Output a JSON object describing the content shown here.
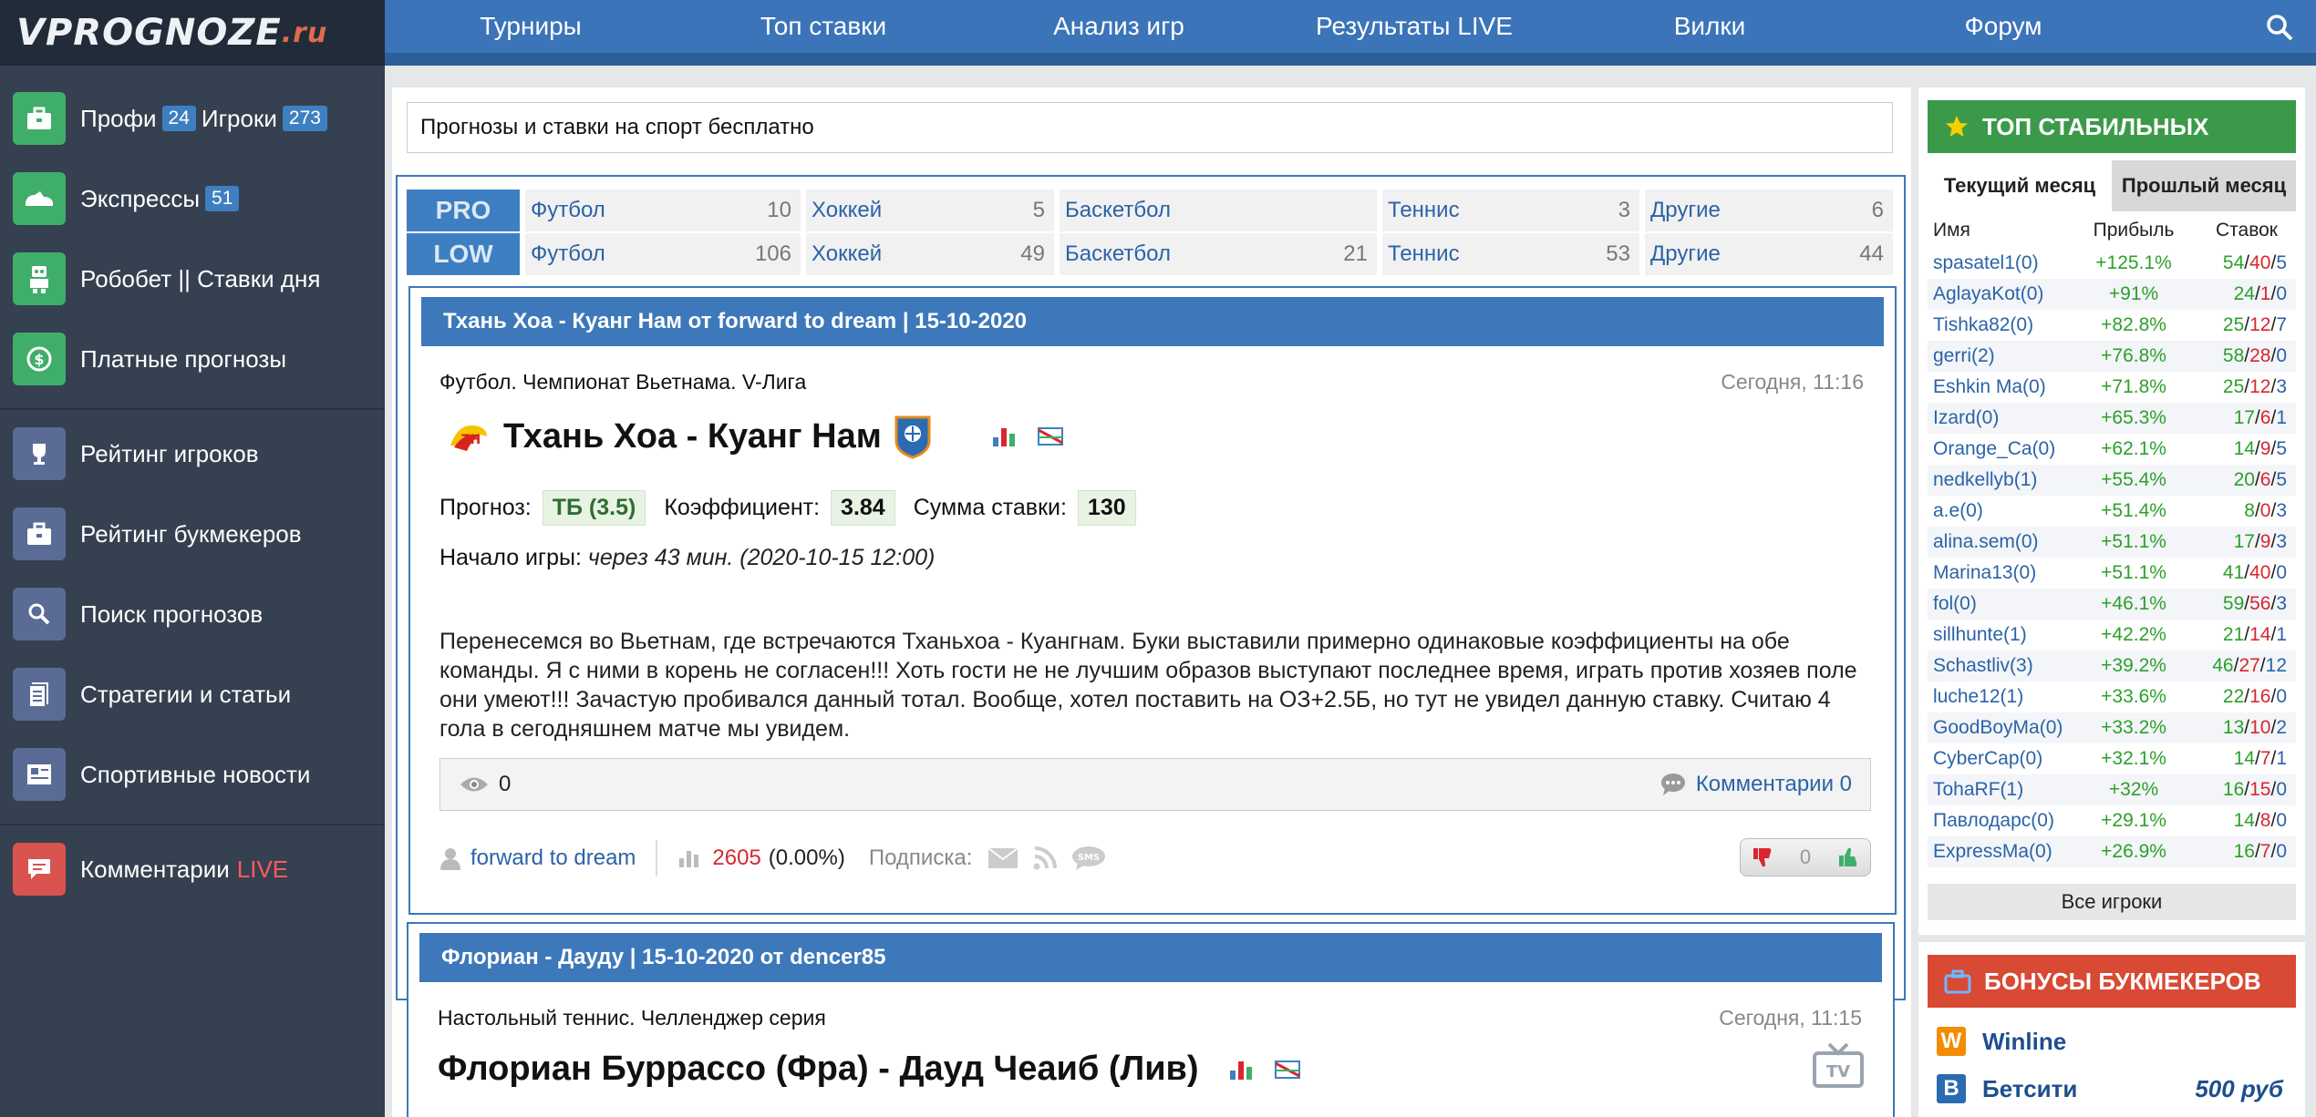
{
  "logo": {
    "main": "VPROGNOZE",
    "tld": ".ru"
  },
  "sidebar": {
    "items": [
      {
        "label": "Профи",
        "badge": "24",
        "label2": "Игроки",
        "badge2": "273"
      },
      {
        "label": "Экспрессы",
        "badge": "51"
      },
      {
        "label": "Робобет || Ставки дня"
      },
      {
        "label": "Платные прогнозы"
      },
      {
        "label": "Рейтинг игроков"
      },
      {
        "label": "Рейтинг букмекеров"
      },
      {
        "label": "Поиск прогнозов"
      },
      {
        "label": "Стратегии и статьи"
      },
      {
        "label": "Спортивные новости"
      },
      {
        "label": "Комментарии",
        "live": "LIVE"
      }
    ]
  },
  "topnav": {
    "items": [
      "Турниры",
      "Топ ставки",
      "Анализ игр",
      "Результаты LIVE",
      "Вилки",
      "Форум"
    ]
  },
  "headline": "Прогнозы и ставки на спорт бесплатно",
  "categories": {
    "pro": {
      "label": "PRO",
      "cells": [
        {
          "name": "Футбол",
          "count": "10"
        },
        {
          "name": "Хоккей",
          "count": "5"
        },
        {
          "name": "Баскетбол",
          "count": ""
        },
        {
          "name": "Теннис",
          "count": "3"
        },
        {
          "name": "Другие",
          "count": "6"
        }
      ]
    },
    "low": {
      "label": "LOW",
      "cells": [
        {
          "name": "Футбол",
          "count": "106"
        },
        {
          "name": "Хоккей",
          "count": "49"
        },
        {
          "name": "Баскетбол",
          "count": "21"
        },
        {
          "name": "Теннис",
          "count": "53"
        },
        {
          "name": "Другие",
          "count": "44"
        }
      ]
    }
  },
  "pred1": {
    "header": "Тхань Хоа - Куанг Нам от forward to dream | 15-10-2020",
    "league": "Футбол. Чемпионат Вьетнама. V-Лига",
    "time": "Сегодня, 11:16",
    "title": "Тхань Хоа - Куанг Нам",
    "forecast_label": "Прогноз:",
    "forecast": "ТБ (3.5)",
    "coef_label": "Коэффициент:",
    "coef": "3.84",
    "stake_label": "Сумма ставки:",
    "stake": "130",
    "start_label": "Начало игры:",
    "start": "через 43 мин. (2020-10-15 12:00)",
    "description": "Перенесемся во Вьетнам, где встречаются Тханьхоа - Куангнам. Буки выставили примерно одинаковые коэффициенты на обе команды. Я с ними в корень не согласен!!! Хоть гости не не лучшим образов выступают последнее время, играть против хозяев поле они умеют!!! Зачастую пробивался данный тотал. Вообще, хотел поставить на ОЗ+2.5Б, но тут не увидел данную ставку. Считаю 4 гола в сегодняшнем матче мы увидем.",
    "views": "0",
    "comments": "Комментарии 0",
    "author": "forward to dream",
    "rating": "2605",
    "rating_pct": "(0.00%)",
    "subscribe": "Подписка:",
    "votes": "0"
  },
  "pred2": {
    "header": "Флориан - Дауду | 15-10-2020 от dencer85",
    "league": "Настольный теннис. Челленджер серия",
    "time": "Сегодня, 11:15",
    "title": "Флориан Буррассо (Фра) - Дауд Чеаиб (Лив)"
  },
  "top": {
    "title": "ТОП СТАБИЛЬНЫХ",
    "tab_current": "Текущий месяц",
    "tab_past": "Прошлый месяц",
    "col_name": "Имя",
    "col_profit": "Прибыль",
    "col_bets": "Ставок",
    "rows": [
      {
        "name": "spasatel1(0)",
        "profit": "+125.1%",
        "w": "54",
        "l": "40",
        "d": "5"
      },
      {
        "name": "AglayaKot(0)",
        "profit": "+91%",
        "w": "24",
        "l": "1",
        "d": "0"
      },
      {
        "name": "Tishka82(0)",
        "profit": "+82.8%",
        "w": "25",
        "l": "12",
        "d": "7"
      },
      {
        "name": "gerri(2)",
        "profit": "+76.8%",
        "w": "58",
        "l": "28",
        "d": "0"
      },
      {
        "name": "Eshkin Ma(0)",
        "profit": "+71.8%",
        "w": "25",
        "l": "12",
        "d": "3"
      },
      {
        "name": "Izard(0)",
        "profit": "+65.3%",
        "w": "17",
        "l": "6",
        "d": "1"
      },
      {
        "name": "Orange_Ca(0)",
        "profit": "+62.1%",
        "w": "14",
        "l": "9",
        "d": "5"
      },
      {
        "name": "nedkellyb(1)",
        "profit": "+55.4%",
        "w": "20",
        "l": "6",
        "d": "5"
      },
      {
        "name": "a.e(0)",
        "profit": "+51.4%",
        "w": "8",
        "l": "0",
        "d": "3"
      },
      {
        "name": "alina.sem(0)",
        "profit": "+51.1%",
        "w": "17",
        "l": "9",
        "d": "3"
      },
      {
        "name": "Marina13(0)",
        "profit": "+51.1%",
        "w": "41",
        "l": "40",
        "d": "0"
      },
      {
        "name": "fol(0)",
        "profit": "+46.1%",
        "w": "59",
        "l": "56",
        "d": "3"
      },
      {
        "name": "sillhunte(1)",
        "profit": "+42.2%",
        "w": "21",
        "l": "14",
        "d": "1"
      },
      {
        "name": "Schastliv(3)",
        "profit": "+39.2%",
        "w": "46",
        "l": "27",
        "d": "12"
      },
      {
        "name": "luche12(1)",
        "profit": "+33.6%",
        "w": "22",
        "l": "16",
        "d": "0"
      },
      {
        "name": "GoodBoyMa(0)",
        "profit": "+33.2%",
        "w": "13",
        "l": "10",
        "d": "2"
      },
      {
        "name": "CyberCap(0)",
        "profit": "+32.1%",
        "w": "14",
        "l": "7",
        "d": "1"
      },
      {
        "name": "TohaRF(1)",
        "profit": "+32%",
        "w": "16",
        "l": "15",
        "d": "0"
      },
      {
        "name": "Павлодарс(0)",
        "profit": "+29.1%",
        "w": "14",
        "l": "8",
        "d": "0"
      },
      {
        "name": "ExpressMa(0)",
        "profit": "+26.9%",
        "w": "16",
        "l": "7",
        "d": "0"
      }
    ],
    "all_players": "Все игроки"
  },
  "bonus": {
    "title": "БОНУСЫ БУКМЕКЕРОВ",
    "items": [
      {
        "name": "Winline",
        "letter": "W",
        "amount": ""
      },
      {
        "name": "Бетсити",
        "letter": "B",
        "amount": "500 руб"
      }
    ]
  },
  "colors": {
    "brand_blue": "#3b74b8",
    "sidebar": "#354050",
    "green": "#3a9a4a",
    "red": "#d84a34"
  }
}
